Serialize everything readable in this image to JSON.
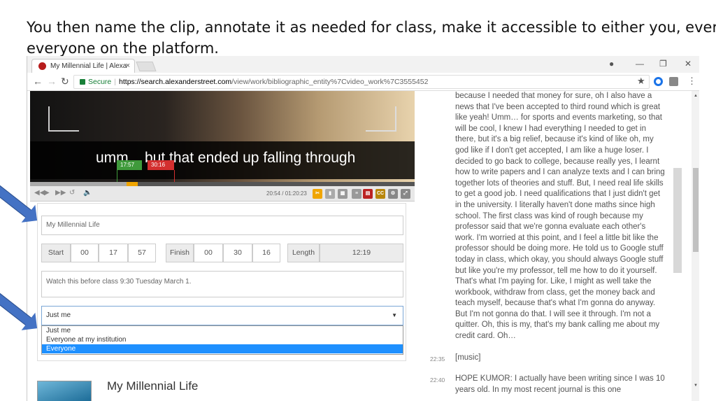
{
  "slide": {
    "line1": "You then name the clip, annotate it as needed for class, make it accessible to either you, everyone at your i",
    "line2": "everyone on the platform."
  },
  "browser": {
    "tab_title": "My Millennial Life | Alexa",
    "tab_close": "×",
    "secure_label": "Secure",
    "url_host": "https://search.alexanderstreet.com",
    "url_path": "/view/work/bibliographic_entity%7Cvideo_work%7C3555452",
    "icons": [
      "back-icon",
      "forward-icon",
      "reload-icon",
      "star-icon",
      "account-icon",
      "minimize-icon",
      "restore-icon",
      "close-icon",
      "menu-icon"
    ]
  },
  "video": {
    "subtitle": "umm... but that ended up falling through",
    "mark_start": "17:57",
    "mark_end": "30:16",
    "timecode": "20:54 / 01:20:23",
    "progress": 0.26,
    "accent_green": "#3f9a3b",
    "accent_red": "#d32f2f",
    "accent_orange": "#f0a500"
  },
  "form": {
    "clip_title": "My Millennial Life",
    "start_label": "Start",
    "start_h": "00",
    "start_m": "17",
    "start_s": "57",
    "finish_label": "Finish",
    "finish_h": "00",
    "finish_m": "30",
    "finish_s": "16",
    "length_label": "Length",
    "length_value": "12:19",
    "annotation": "Watch this before class 9:30 Tuesday March 1.",
    "visibility_selected": "Just me",
    "visibility_options": [
      "Just me",
      "Everyone at my institution",
      "Everyone"
    ],
    "highlighted_option": "Everyone"
  },
  "bottom": {
    "title": "My Millennial Life"
  },
  "transcript": {
    "paragraph": "because I needed that money for sure, oh I also have a news that I've been accepted to third round which is great like yeah! Umm… for sports and events marketing, so that will be cool, I knew I had everything I needed to get in there, but it's a big relief, because it's kind of like oh, my god like if I don't get accepted, I am like a huge loser. I decided to go back to college, because really yes, I learnt how to write papers and I can analyze texts and I can bring together lots of theories and stuff. But, I need real life skills to get a good job. I need qualifications that I just didn't get in the university. I literally haven't done maths since high school. The first class was kind of rough because my professor said that we're gonna evaluate each other's work. I'm worried at this point, and I feel a little bit like the professor should be doing more. He told us to Google stuff today in class, which okay, you should always Google stuff but like you're my professor, tell me how to do it yourself. That's what I'm paying for. Like, I might as well take the workbook, withdraw from class, get the money back and teach myself, because that's what I'm gonna do anyway. But I'm not gonna do that. I will see it through. I'm not a quitter. Oh, this is my, that's my bank calling me about my credit card. Oh…",
    "entry2_time": "22:35",
    "entry2_text": "[music]",
    "entry3_time": "22:40",
    "entry3_text": "HOPE KUMOR: I actually have been writing since I was 10 years old. In my most recent journal is this one"
  }
}
